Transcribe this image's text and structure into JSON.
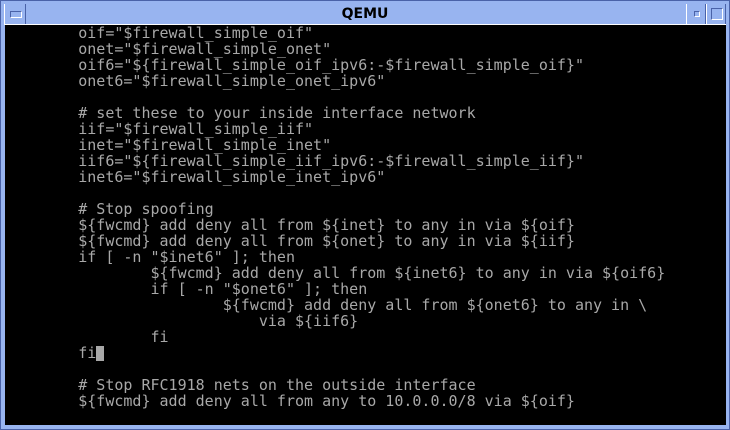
{
  "window": {
    "title": "QEMU"
  },
  "colors": {
    "titlebar": "#98b4f0",
    "screen_bg": "#000000",
    "text": "#a8a8a8"
  },
  "icons": {
    "menu": "window-menu-icon",
    "iconify": "iconify-icon",
    "maximize": "maximize-icon"
  },
  "terminal": {
    "lines": [
      "        oif=\"$firewall_simple_oif\"",
      "        onet=\"$firewall_simple_onet\"",
      "        oif6=\"${firewall_simple_oif_ipv6:-$firewall_simple_oif}\"",
      "        onet6=\"$firewall_simple_onet_ipv6\"",
      "",
      "        # set these to your inside interface network",
      "        iif=\"$firewall_simple_iif\"",
      "        inet=\"$firewall_simple_inet\"",
      "        iif6=\"${firewall_simple_iif_ipv6:-$firewall_simple_iif}\"",
      "        inet6=\"$firewall_simple_inet_ipv6\"",
      "",
      "        # Stop spoofing",
      "        ${fwcmd} add deny all from ${inet} to any in via ${oif}",
      "        ${fwcmd} add deny all from ${onet} to any in via ${iif}",
      "        if [ -n \"$inet6\" ]; then",
      "                ${fwcmd} add deny all from ${inet6} to any in via ${oif6}",
      "                if [ -n \"$onet6\" ]; then",
      "                        ${fwcmd} add deny all from ${onet6} to any in \\",
      "                            via ${iif6}",
      "                fi",
      "        fi",
      "",
      "        # Stop RFC1918 nets on the outside interface",
      "        ${fwcmd} add deny all from any to 10.0.0.0/8 via ${oif}"
    ],
    "cursor_line": 20
  }
}
